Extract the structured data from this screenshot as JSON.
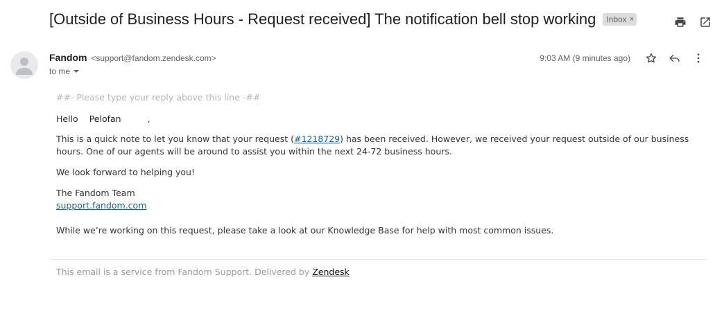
{
  "subject": {
    "title": "[Outside of Business Hours - Request received] The notification bell stop working",
    "label": "Inbox",
    "label_remove": "×"
  },
  "sender": {
    "name": "Fandom",
    "email": "<support@fandom.zendesk.com>",
    "recipient": "to me",
    "timestamp": "9:03 AM (9 minutes ago)"
  },
  "body": {
    "reply_line": "##- Please type your reply above this line -##",
    "greeting_hello": "Hello",
    "greeting_name": "Pelofan",
    "greeting_comma": ",",
    "para1_before": "This is a quick note to let you know that your request (",
    "request_link": "#1218729",
    "para1_after": ") has been received. However, we received your request outside of our business hours. One of our agents will be around to assist you within the next 24-72 business hours.",
    "para2": "We look forward to helping you!",
    "signature_team": "The Fandom Team",
    "signature_link": "support.fandom.com",
    "para3": "While we’re working on this request, please take a look at our Knowledge Base for help with most common issues."
  },
  "footer": {
    "text": "This email is a service from Fandom Support. Delivered by ",
    "link": "Zendesk"
  },
  "icons": {
    "print": "print-icon",
    "open_new": "open-in-new-window-icon",
    "star": "star-icon",
    "reply": "reply-icon",
    "more": "more-vertical-icon",
    "avatar": "person-icon",
    "caret": "caret-down-icon"
  },
  "colors": {
    "link": "#1a5f9c",
    "label_bg": "#dddddd",
    "muted": "#5f6368"
  }
}
